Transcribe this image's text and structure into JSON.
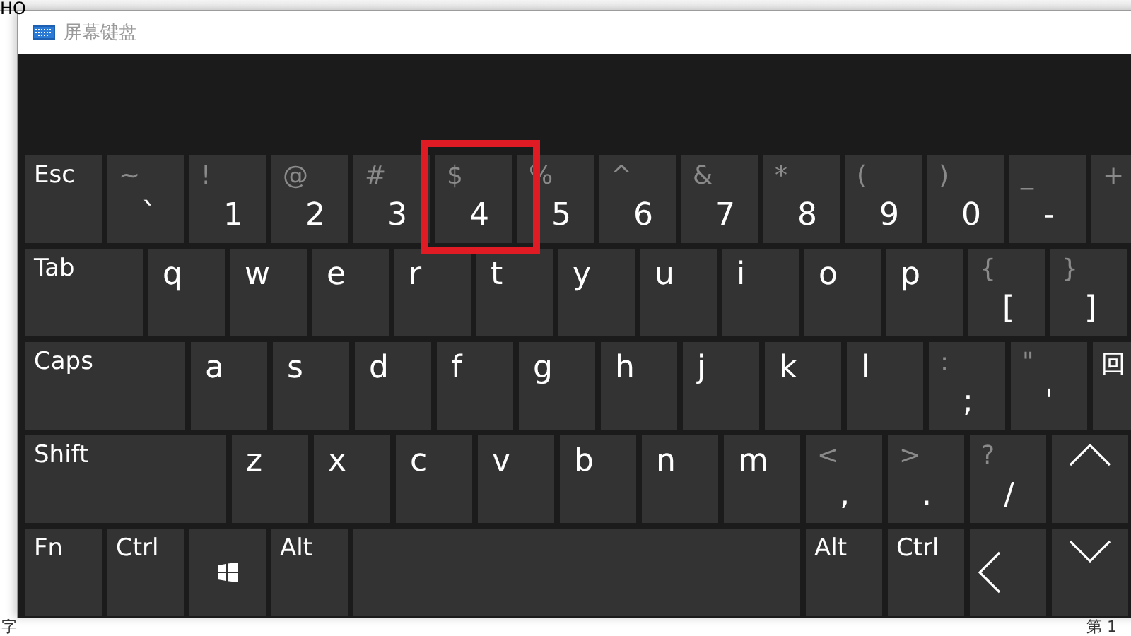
{
  "background": {
    "top_text": "HO",
    "bottom_left_text": "字",
    "bottom_right_text": "第 1"
  },
  "window": {
    "title": "屏幕键盘"
  },
  "keyboard": {
    "rows": [
      {
        "keys": [
          {
            "kind": "label",
            "main": "Esc"
          },
          {
            "kind": "char",
            "top": "~",
            "main": "`"
          },
          {
            "kind": "char",
            "top": "!",
            "main": "1"
          },
          {
            "kind": "char",
            "top": "@",
            "main": "2"
          },
          {
            "kind": "char",
            "top": "#",
            "main": "3"
          },
          {
            "kind": "char",
            "top": "$",
            "main": "4",
            "highlighted": true
          },
          {
            "kind": "char",
            "top": "%",
            "main": "5"
          },
          {
            "kind": "char",
            "top": "^",
            "main": "6"
          },
          {
            "kind": "char",
            "top": "&",
            "main": "7"
          },
          {
            "kind": "char",
            "top": "*",
            "main": "8"
          },
          {
            "kind": "char",
            "top": "(",
            "main": "9"
          },
          {
            "kind": "char",
            "top": ")",
            "main": "0"
          },
          {
            "kind": "char",
            "top": "_",
            "main": "-"
          },
          {
            "kind": "char",
            "top": "+"
          }
        ]
      },
      {
        "keys": [
          {
            "kind": "tab",
            "main": "Tab"
          },
          {
            "kind": "letter",
            "main": "q"
          },
          {
            "kind": "letter",
            "main": "w"
          },
          {
            "kind": "letter",
            "main": "e"
          },
          {
            "kind": "letter",
            "main": "r"
          },
          {
            "kind": "letter",
            "main": "t"
          },
          {
            "kind": "letter",
            "main": "y"
          },
          {
            "kind": "letter",
            "main": "u"
          },
          {
            "kind": "letter",
            "main": "i"
          },
          {
            "kind": "letter",
            "main": "o"
          },
          {
            "kind": "letter",
            "main": "p"
          },
          {
            "kind": "char",
            "top": "{",
            "main": "["
          },
          {
            "kind": "char",
            "top": "}",
            "main": "]"
          }
        ]
      },
      {
        "keys": [
          {
            "kind": "caps",
            "main": "Caps"
          },
          {
            "kind": "letter",
            "main": "a"
          },
          {
            "kind": "letter",
            "main": "s"
          },
          {
            "kind": "letter",
            "main": "d"
          },
          {
            "kind": "letter",
            "main": "f"
          },
          {
            "kind": "letter",
            "main": "g"
          },
          {
            "kind": "letter",
            "main": "h"
          },
          {
            "kind": "letter",
            "main": "j"
          },
          {
            "kind": "letter",
            "main": "k"
          },
          {
            "kind": "letter",
            "main": "l"
          },
          {
            "kind": "char",
            "top": ":",
            "main": ";"
          },
          {
            "kind": "char",
            "top": "\"",
            "main": "'"
          },
          {
            "kind": "enter",
            "main": "回"
          }
        ]
      },
      {
        "keys": [
          {
            "kind": "shift",
            "main": "Shift"
          },
          {
            "kind": "letter",
            "main": "z"
          },
          {
            "kind": "letter",
            "main": "x"
          },
          {
            "kind": "letter",
            "main": "c"
          },
          {
            "kind": "letter",
            "main": "v"
          },
          {
            "kind": "letter",
            "main": "b"
          },
          {
            "kind": "letter",
            "main": "n"
          },
          {
            "kind": "letter",
            "main": "m"
          },
          {
            "kind": "char",
            "top": "<",
            "main": ","
          },
          {
            "kind": "char",
            "top": ">",
            "main": "."
          },
          {
            "kind": "char",
            "top": "?",
            "main": "/"
          },
          {
            "kind": "up"
          }
        ]
      },
      {
        "keys": [
          {
            "kind": "label",
            "main": "Fn"
          },
          {
            "kind": "label",
            "main": "Ctrl"
          },
          {
            "kind": "win"
          },
          {
            "kind": "label",
            "main": "Alt"
          },
          {
            "kind": "space"
          },
          {
            "kind": "label",
            "main": "Alt"
          },
          {
            "kind": "label",
            "main": "Ctrl"
          },
          {
            "kind": "left"
          },
          {
            "kind": "down"
          }
        ]
      }
    ]
  }
}
